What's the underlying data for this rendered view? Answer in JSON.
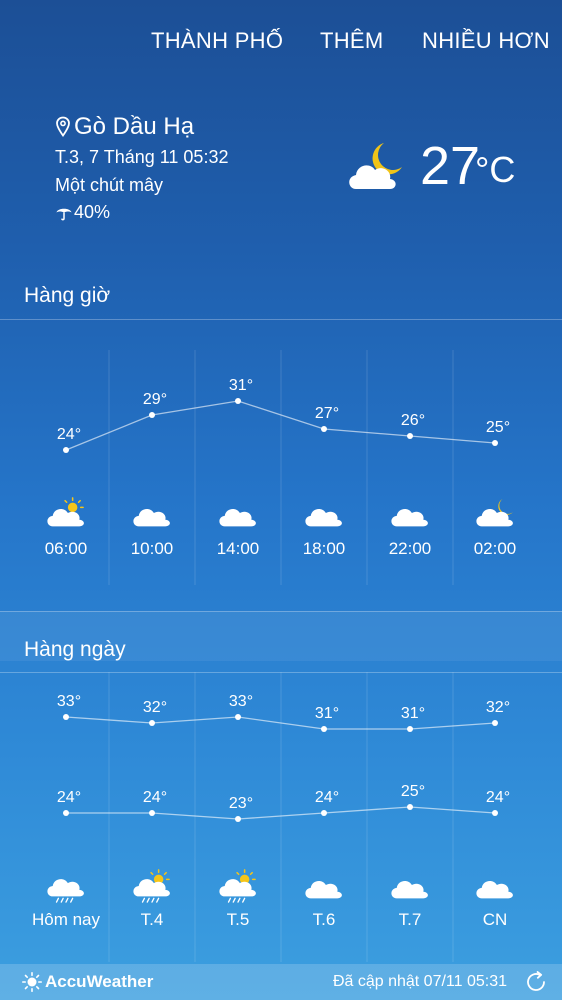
{
  "nav": {
    "city": "THÀNH PHỐ",
    "more": "THÊM",
    "extra": "NHIỀU HƠN"
  },
  "current": {
    "location": "Gò Dầu Hạ",
    "date": "T.3, 7 Tháng 11 05:32",
    "condition": "Một chút mây",
    "precip": "40%",
    "temp": "27",
    "unit": "°C",
    "icon": "partly-cloudy-night-icon"
  },
  "hourly": {
    "title": "Hàng giờ",
    "items": [
      {
        "time": "06:00",
        "temp": 24,
        "label": "24°",
        "icon": "partly-sunny"
      },
      {
        "time": "10:00",
        "temp": 29,
        "label": "29°",
        "icon": "cloudy"
      },
      {
        "time": "14:00",
        "temp": 31,
        "label": "31°",
        "icon": "cloudy"
      },
      {
        "time": "18:00",
        "temp": 27,
        "label": "27°",
        "icon": "cloudy"
      },
      {
        "time": "22:00",
        "temp": 26,
        "label": "26°",
        "icon": "cloudy"
      },
      {
        "time": "02:00",
        "temp": 25,
        "label": "25°",
        "icon": "partly-cloudy-night"
      }
    ]
  },
  "daily": {
    "title": "Hàng ngày",
    "items": [
      {
        "day": "Hôm nay",
        "high": 33,
        "high_label": "33°",
        "low": 24,
        "low_label": "24°",
        "icon": "rain"
      },
      {
        "day": "T.4",
        "high": 32,
        "high_label": "32°",
        "low": 24,
        "low_label": "24°",
        "icon": "sun-rain"
      },
      {
        "day": "T.5",
        "high": 33,
        "high_label": "33°",
        "low": 23,
        "low_label": "23°",
        "icon": "sun-rain"
      },
      {
        "day": "T.6",
        "high": 31,
        "high_label": "31°",
        "low": 24,
        "low_label": "24°",
        "icon": "cloudy"
      },
      {
        "day": "T.7",
        "high": 31,
        "high_label": "31°",
        "low": 25,
        "low_label": "25°",
        "icon": "cloudy"
      },
      {
        "day": "CN",
        "high": 32,
        "high_label": "32°",
        "low": 24,
        "low_label": "24°",
        "icon": "cloudy"
      }
    ]
  },
  "footer": {
    "brand": "AccuWeather",
    "updated": "Đã cập nhật 07/11  05:31"
  },
  "colors": {
    "sun": "#f5c518",
    "moon": "#f0c419",
    "cloud": "#ffffff",
    "rain": "#ffffff"
  }
}
